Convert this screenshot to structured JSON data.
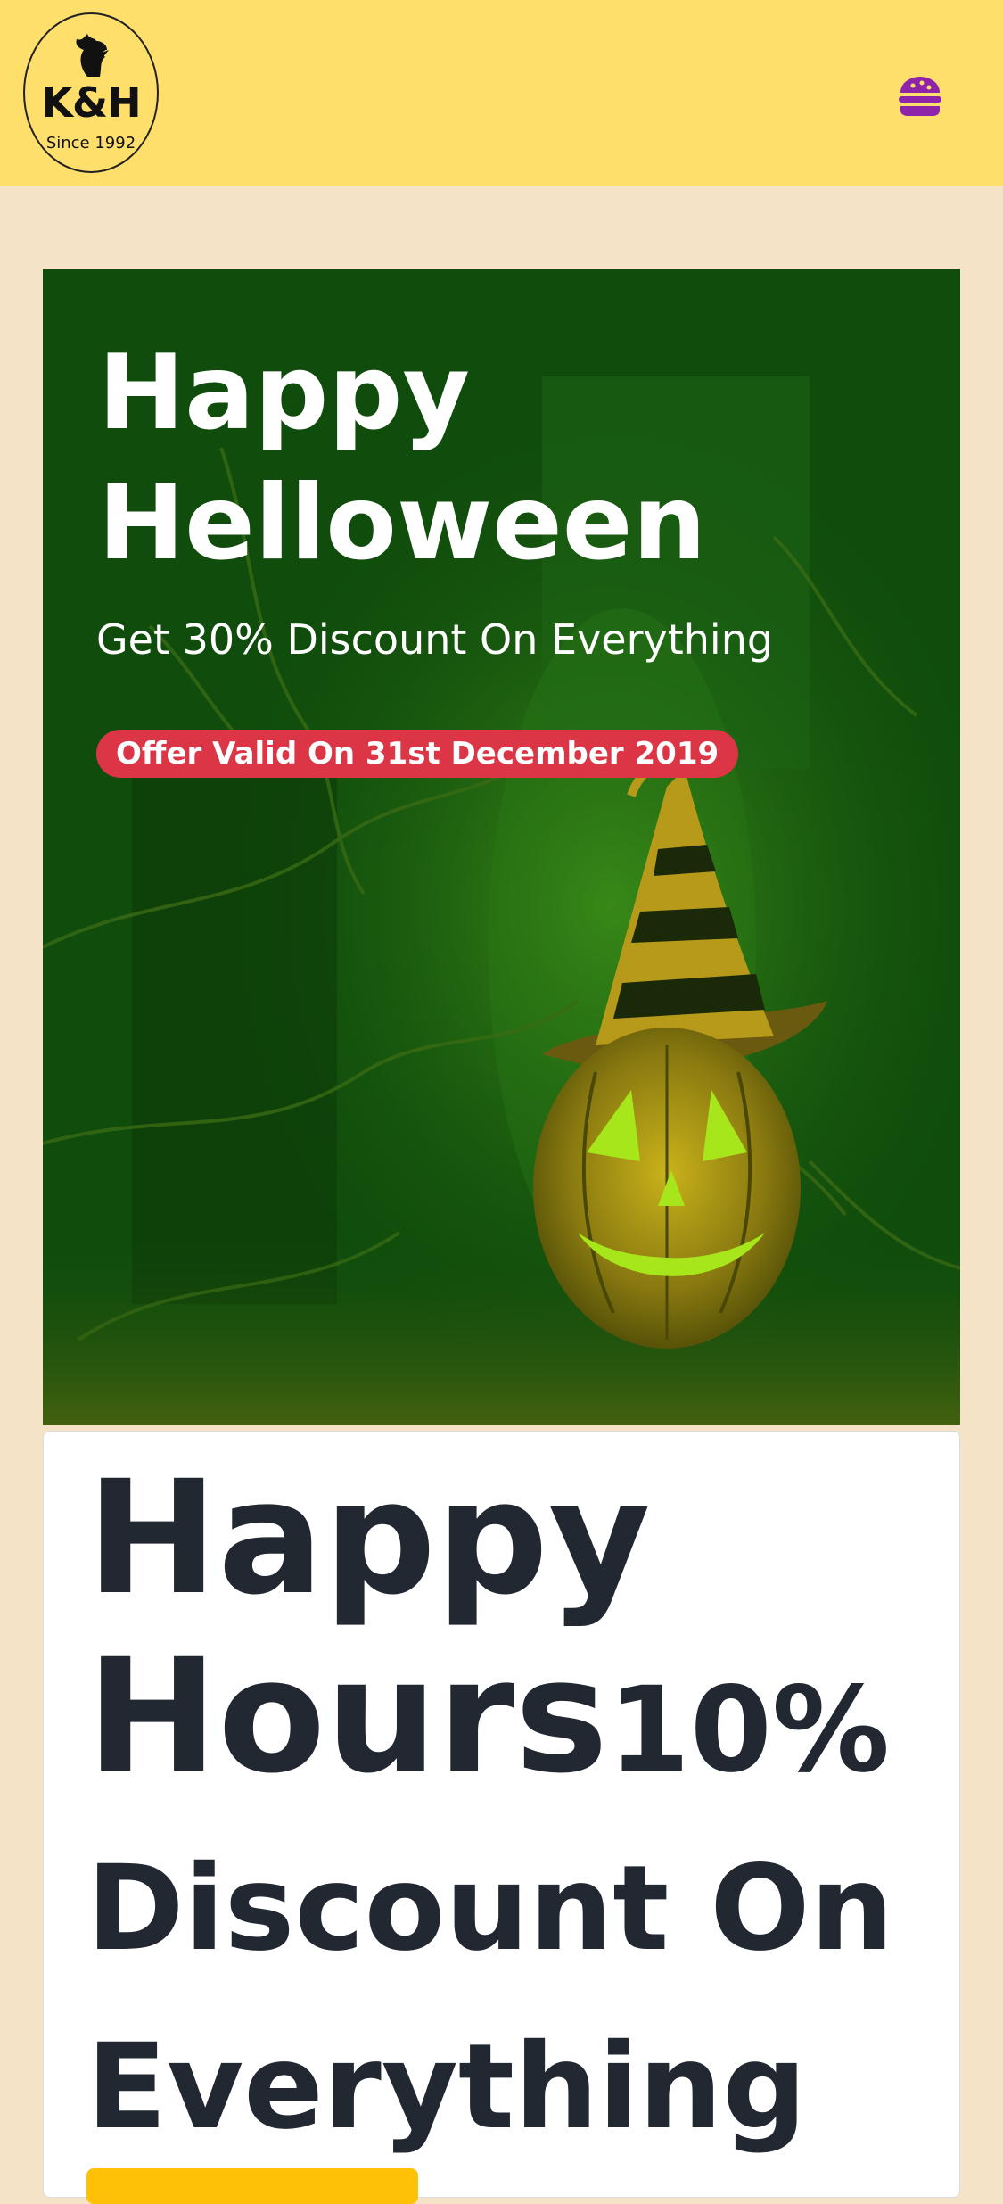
{
  "header": {
    "logo": {
      "mark": "K&H",
      "since": "Since 1992"
    },
    "menu_icon": "burger-icon",
    "colors": {
      "background": "#ffdf6b",
      "menu_icon": "#8e24aa"
    }
  },
  "hero": {
    "title": "Happy\nHelloween",
    "subtitle": "Get 30% Discount On Everything",
    "badge": "Offer Valid On 31st December 2019",
    "image": "halloween-pumpkin-with-witch-hat",
    "colors": {
      "overlay": "#0f4a0c",
      "badge": "#dc3545"
    }
  },
  "card": {
    "title_line1": "Happy",
    "title_line2": "Hours",
    "title_line2_suffix": "10%",
    "title_line3": "Discount On",
    "title_line4": "Everything",
    "colors": {
      "text": "#222831",
      "button": "#ffc107"
    }
  },
  "page": {
    "background": "#f5e3c8"
  }
}
